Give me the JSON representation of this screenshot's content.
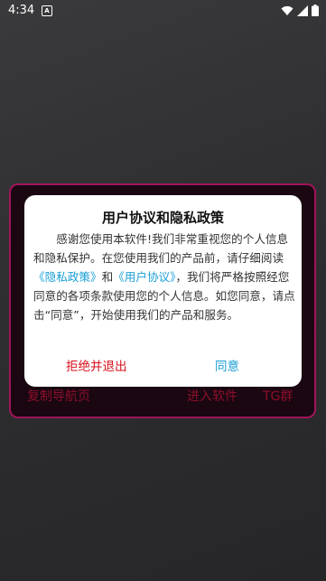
{
  "status_bar": {
    "time": "4:34",
    "notification_glyph": "A",
    "icons": [
      "wifi-icon",
      "signal-icon",
      "battery-icon"
    ]
  },
  "background": {
    "copy_nav": "复制导航页",
    "enter": "进入软件",
    "tg": "TG群"
  },
  "dialog": {
    "title": "用户协议和隐私政策",
    "body_1": "感谢您使用本软件!我们非常重视您的个人信息和隐私保护。在您使用我们的产品前，请仔细阅读",
    "link_privacy": "《隐私政策》",
    "and": "和",
    "link_terms": "《用户协议》",
    "body_2": "，我们将严格按照经您同意的各项条款使用您的个人信息。如您同意，请点击“同意”，开始使用我们的产品和服务。",
    "decline_label": "拒绝并退出",
    "agree_label": "同意"
  },
  "colors": {
    "decline": "#d8121e",
    "link": "#1a9fd6",
    "panel_border": "#a0145a"
  }
}
